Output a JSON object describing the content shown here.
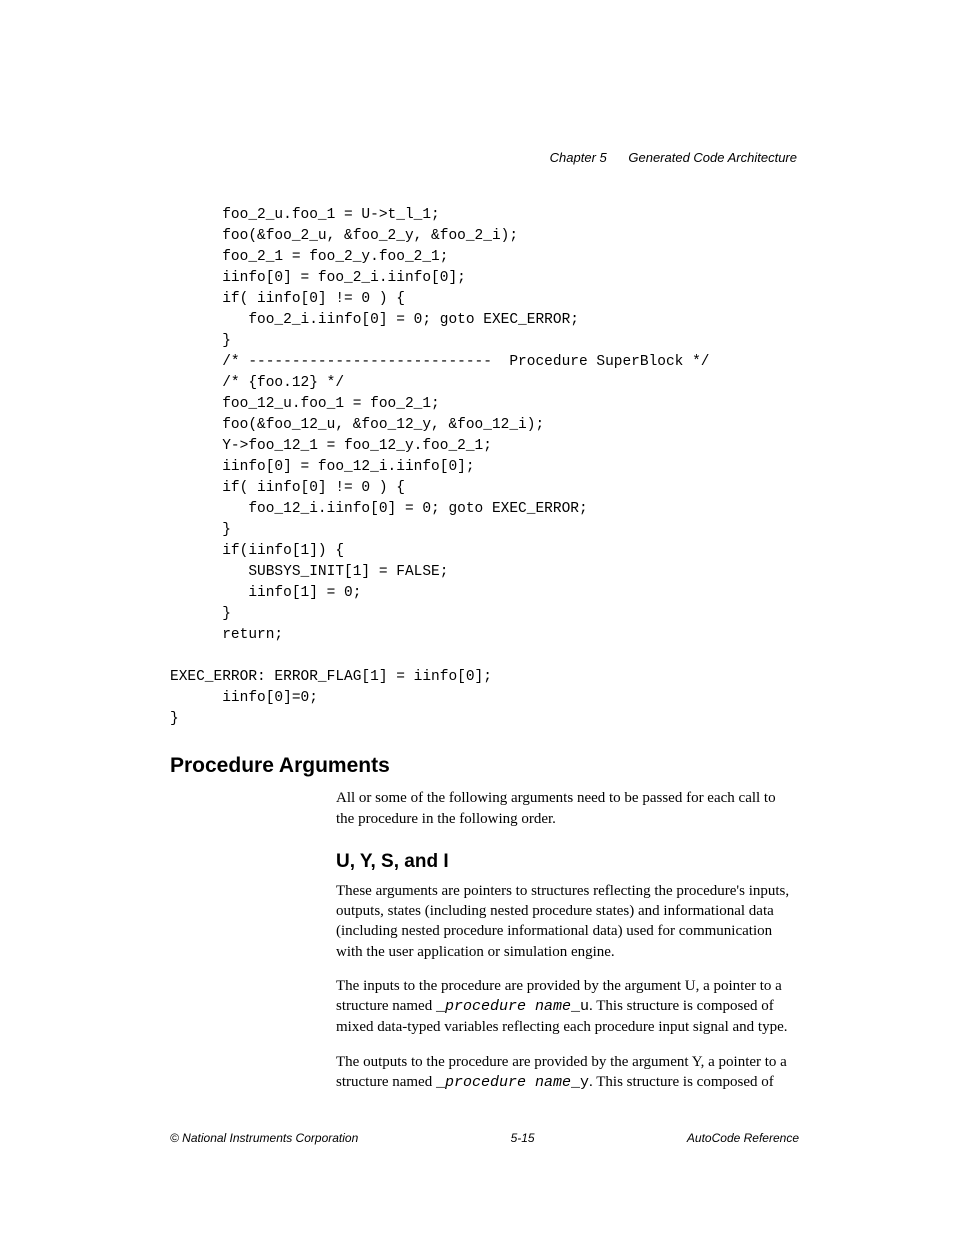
{
  "header": {
    "chapter_label": "Chapter 5",
    "chapter_title": "Generated Code Architecture"
  },
  "code": {
    "lines": "      foo_2_u.foo_1 = U->t_l_1;\n      foo(&foo_2_u, &foo_2_y, &foo_2_i);\n      foo_2_1 = foo_2_y.foo_2_1;\n      iinfo[0] = foo_2_i.iinfo[0];\n      if( iinfo[0] != 0 ) {\n         foo_2_i.iinfo[0] = 0; goto EXEC_ERROR;\n      }\n      /* ----------------------------  Procedure SuperBlock */\n      /* {foo.12} */\n      foo_12_u.foo_1 = foo_2_1;\n      foo(&foo_12_u, &foo_12_y, &foo_12_i);\n      Y->foo_12_1 = foo_12_y.foo_2_1;\n      iinfo[0] = foo_12_i.iinfo[0];\n      if( iinfo[0] != 0 ) {\n         foo_12_i.iinfo[0] = 0; goto EXEC_ERROR;\n      }\n      if(iinfo[1]) {\n         SUBSYS_INIT[1] = FALSE;\n         iinfo[1] = 0;\n      }\n      return;\n\nEXEC_ERROR: ERROR_FLAG[1] = iinfo[0];\n      iinfo[0]=0;\n}"
  },
  "section": {
    "heading": "Procedure Arguments",
    "intro": "All or some of the following arguments need to be passed for each call to the procedure in the following order.",
    "subheading": "U, Y, S, and I",
    "p1": "These arguments are pointers to structures reflecting the procedure's inputs, outputs, states (including nested procedure states) and informational data (including nested procedure informational data) used for communication with the user application or simulation engine.",
    "p2_pre": "The inputs to the procedure are provided by the argument U, a pointer to a structure named ",
    "p2_code_prefix": "_",
    "p2_code_ital": "procedure name",
    "p2_code_suffix": "_u",
    "p2_post": ". This structure is composed of mixed data-typed variables reflecting each procedure input signal and type.",
    "p3_pre": "The outputs to the procedure are provided by the argument Y, a pointer to a structure named ",
    "p3_code_prefix": "_",
    "p3_code_ital": "procedure name",
    "p3_code_suffix": "_y",
    "p3_post": ". This structure is composed of"
  },
  "footer": {
    "copyright": "© National Instruments Corporation",
    "page_number": "5-15",
    "doc_title": "AutoCode Reference"
  }
}
